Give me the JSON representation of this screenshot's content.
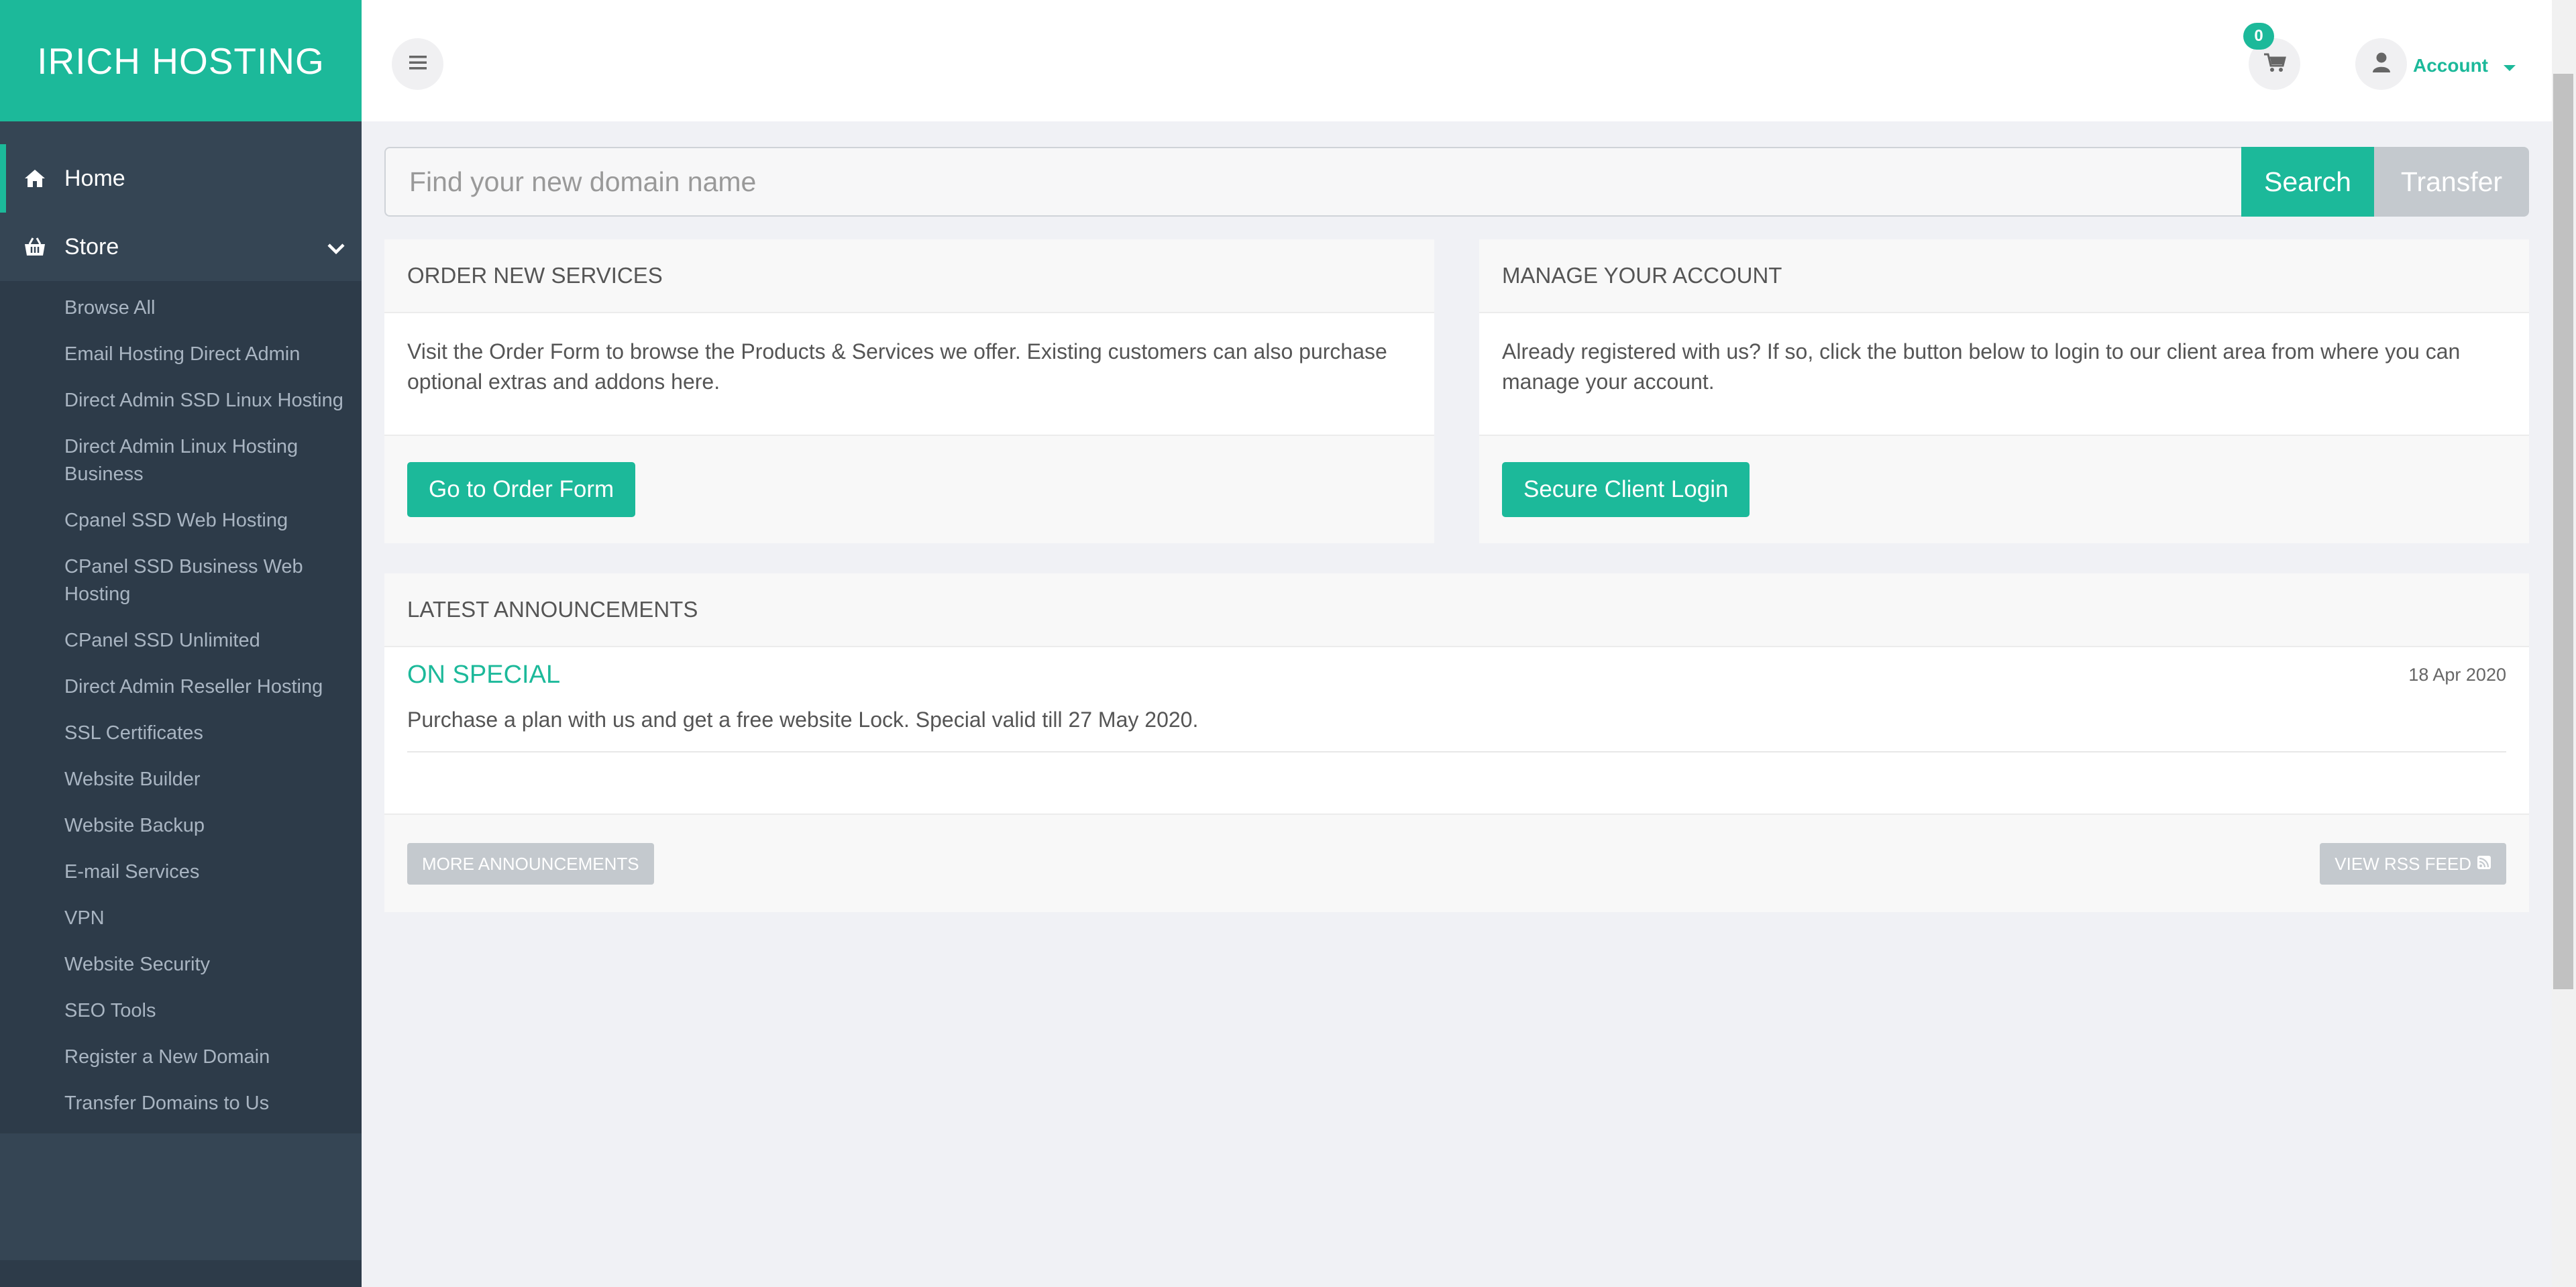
{
  "brand": {
    "title": "IRICH HOSTING",
    "color": "#1cb99a"
  },
  "sidebar": {
    "home": {
      "label": "Home",
      "icon": "home-icon"
    },
    "store": {
      "label": "Store",
      "icon": "basket-icon"
    },
    "store_items": [
      "Browse All",
      "Email Hosting Direct Admin",
      "Direct Admin SSD Linux Hosting",
      "Direct Admin Linux Hosting Business",
      "Cpanel SSD Web Hosting",
      "CPanel SSD Business Web Hosting",
      "CPanel SSD Unlimited",
      "Direct Admin Reseller Hosting",
      "SSL Certificates",
      "Website Builder",
      "Website Backup",
      "E-mail Services",
      "VPN",
      "Website Security",
      "SEO Tools",
      "Register a New Domain",
      "Transfer Domains to Us"
    ]
  },
  "header": {
    "cart_count": "0",
    "account_label": "Account"
  },
  "search": {
    "placeholder": "Find your new domain name",
    "search_label": "Search",
    "transfer_label": "Transfer"
  },
  "order_panel": {
    "title": "ORDER NEW SERVICES",
    "body": "Visit the Order Form to browse the Products & Services we offer. Existing customers can also purchase optional extras and addons here.",
    "button": "Go to Order Form"
  },
  "account_panel": {
    "title": "MANAGE YOUR ACCOUNT",
    "body": "Already registered with us? If so, click the button below to login to our client area from where you can manage your account.",
    "button": "Secure Client Login"
  },
  "announcements": {
    "title": "LATEST ANNOUNCEMENTS",
    "items": [
      {
        "title": "ON SPECIAL",
        "date": "18 Apr 2020",
        "text": "Purchase a plan with us and get a free website Lock. Special valid till 27 May 2020."
      }
    ],
    "more_label": "MORE ANNOUNCEMENTS",
    "rss_label": "VIEW RSS FEED"
  }
}
